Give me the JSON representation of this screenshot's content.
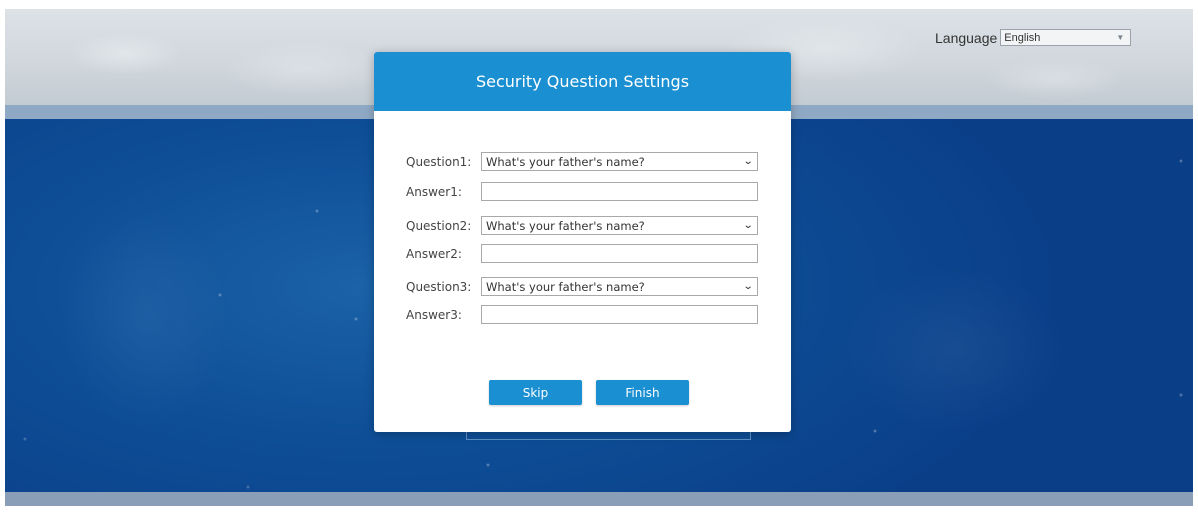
{
  "language": {
    "label": "Language",
    "selected": "English"
  },
  "dialog": {
    "title": "Security Question Settings",
    "rows": [
      {
        "label": "Question1:",
        "type": "select",
        "value": "What's your father's name?"
      },
      {
        "label": "Answer1:",
        "type": "input",
        "value": ""
      },
      {
        "label": "Question2:",
        "type": "select",
        "value": "What's your father's name?"
      },
      {
        "label": "Answer2:",
        "type": "input",
        "value": ""
      },
      {
        "label": "Question3:",
        "type": "select",
        "value": "What's your father's name?"
      },
      {
        "label": "Answer3:",
        "type": "input",
        "value": ""
      }
    ],
    "buttons": {
      "skip": "Skip",
      "finish": "Finish"
    }
  },
  "colors": {
    "accent": "#1a8fd1",
    "background_blue": "#0e4f98"
  }
}
